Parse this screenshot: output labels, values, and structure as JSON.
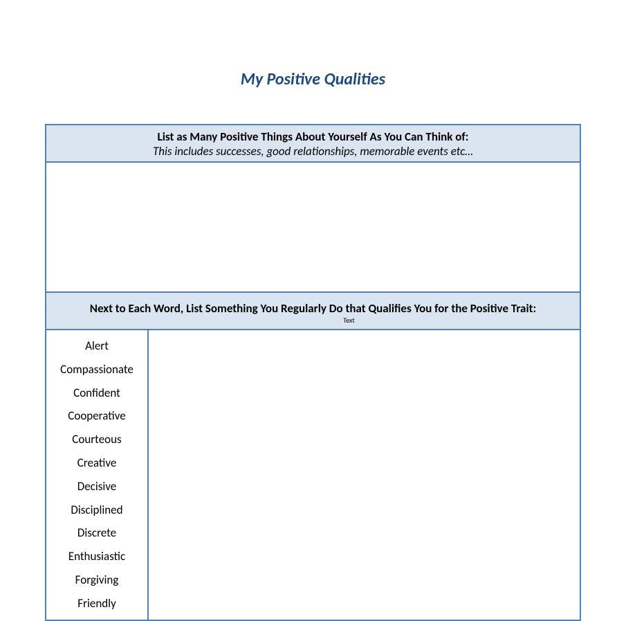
{
  "title": "My Positive Qualities",
  "section1": {
    "heading": "List as Many Positive Things About Yourself As You Can Think of:",
    "subheading": "This includes successes, good relationships, memorable events etc…"
  },
  "section2": {
    "heading": "Next to Each Word, List Something You Regularly Do that Qualifies You for the Positive Trait:",
    "small_label": "Text"
  },
  "traits": [
    "Alert",
    "Compassionate",
    "Confident",
    "Cooperative",
    "Courteous",
    "Creative",
    "Decisive",
    "Disciplined",
    "Discrete",
    "Enthusiastic",
    "Forgiving",
    "Friendly"
  ]
}
